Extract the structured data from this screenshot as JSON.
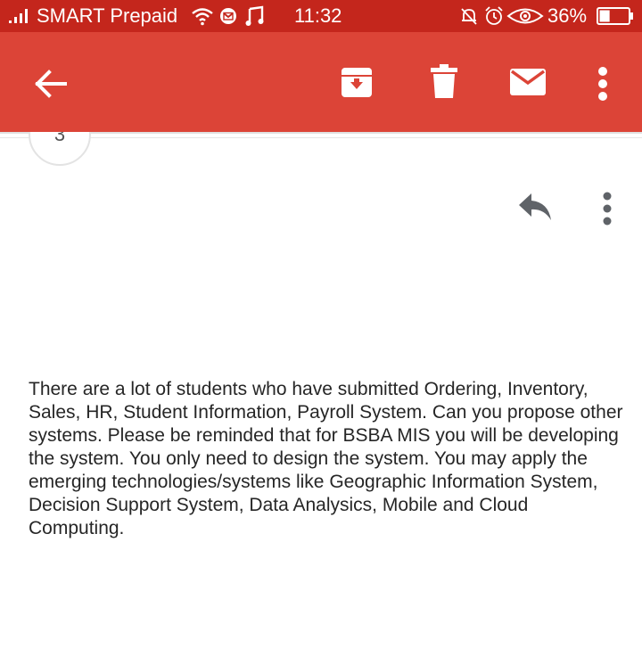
{
  "status_bar": {
    "carrier": "SMART Prepaid",
    "time": "11:32",
    "battery_percent": "36%",
    "icons": [
      "signal-icon",
      "wifi-icon",
      "mail-notification-icon",
      "music-note-icon",
      "bell-off-icon",
      "alarm-icon",
      "eye-comfort-icon",
      "battery-icon"
    ],
    "battery_level": 0.36,
    "background": "#c4261c"
  },
  "app_bar": {
    "background": "#dc4437",
    "actions": [
      "back-arrow-icon",
      "archive-icon",
      "delete-icon",
      "mark-unread-icon",
      "more-vert-icon"
    ]
  },
  "avatar": {
    "initial": "3"
  },
  "message": {
    "actions": [
      "reply-icon",
      "more-vert-icon"
    ],
    "body": "There are a lot of students who have submitted Ordering, Inventory, Sales, HR, Student Information, Payroll System.  Can you propose other systems. Please be reminded that for BSBA MIS you will be developing the system. You only need to design the system. You may apply the emerging technologies/systems like Geographic Information System, Decision Support System, Data Analysics, Mobile and Cloud Computing."
  }
}
